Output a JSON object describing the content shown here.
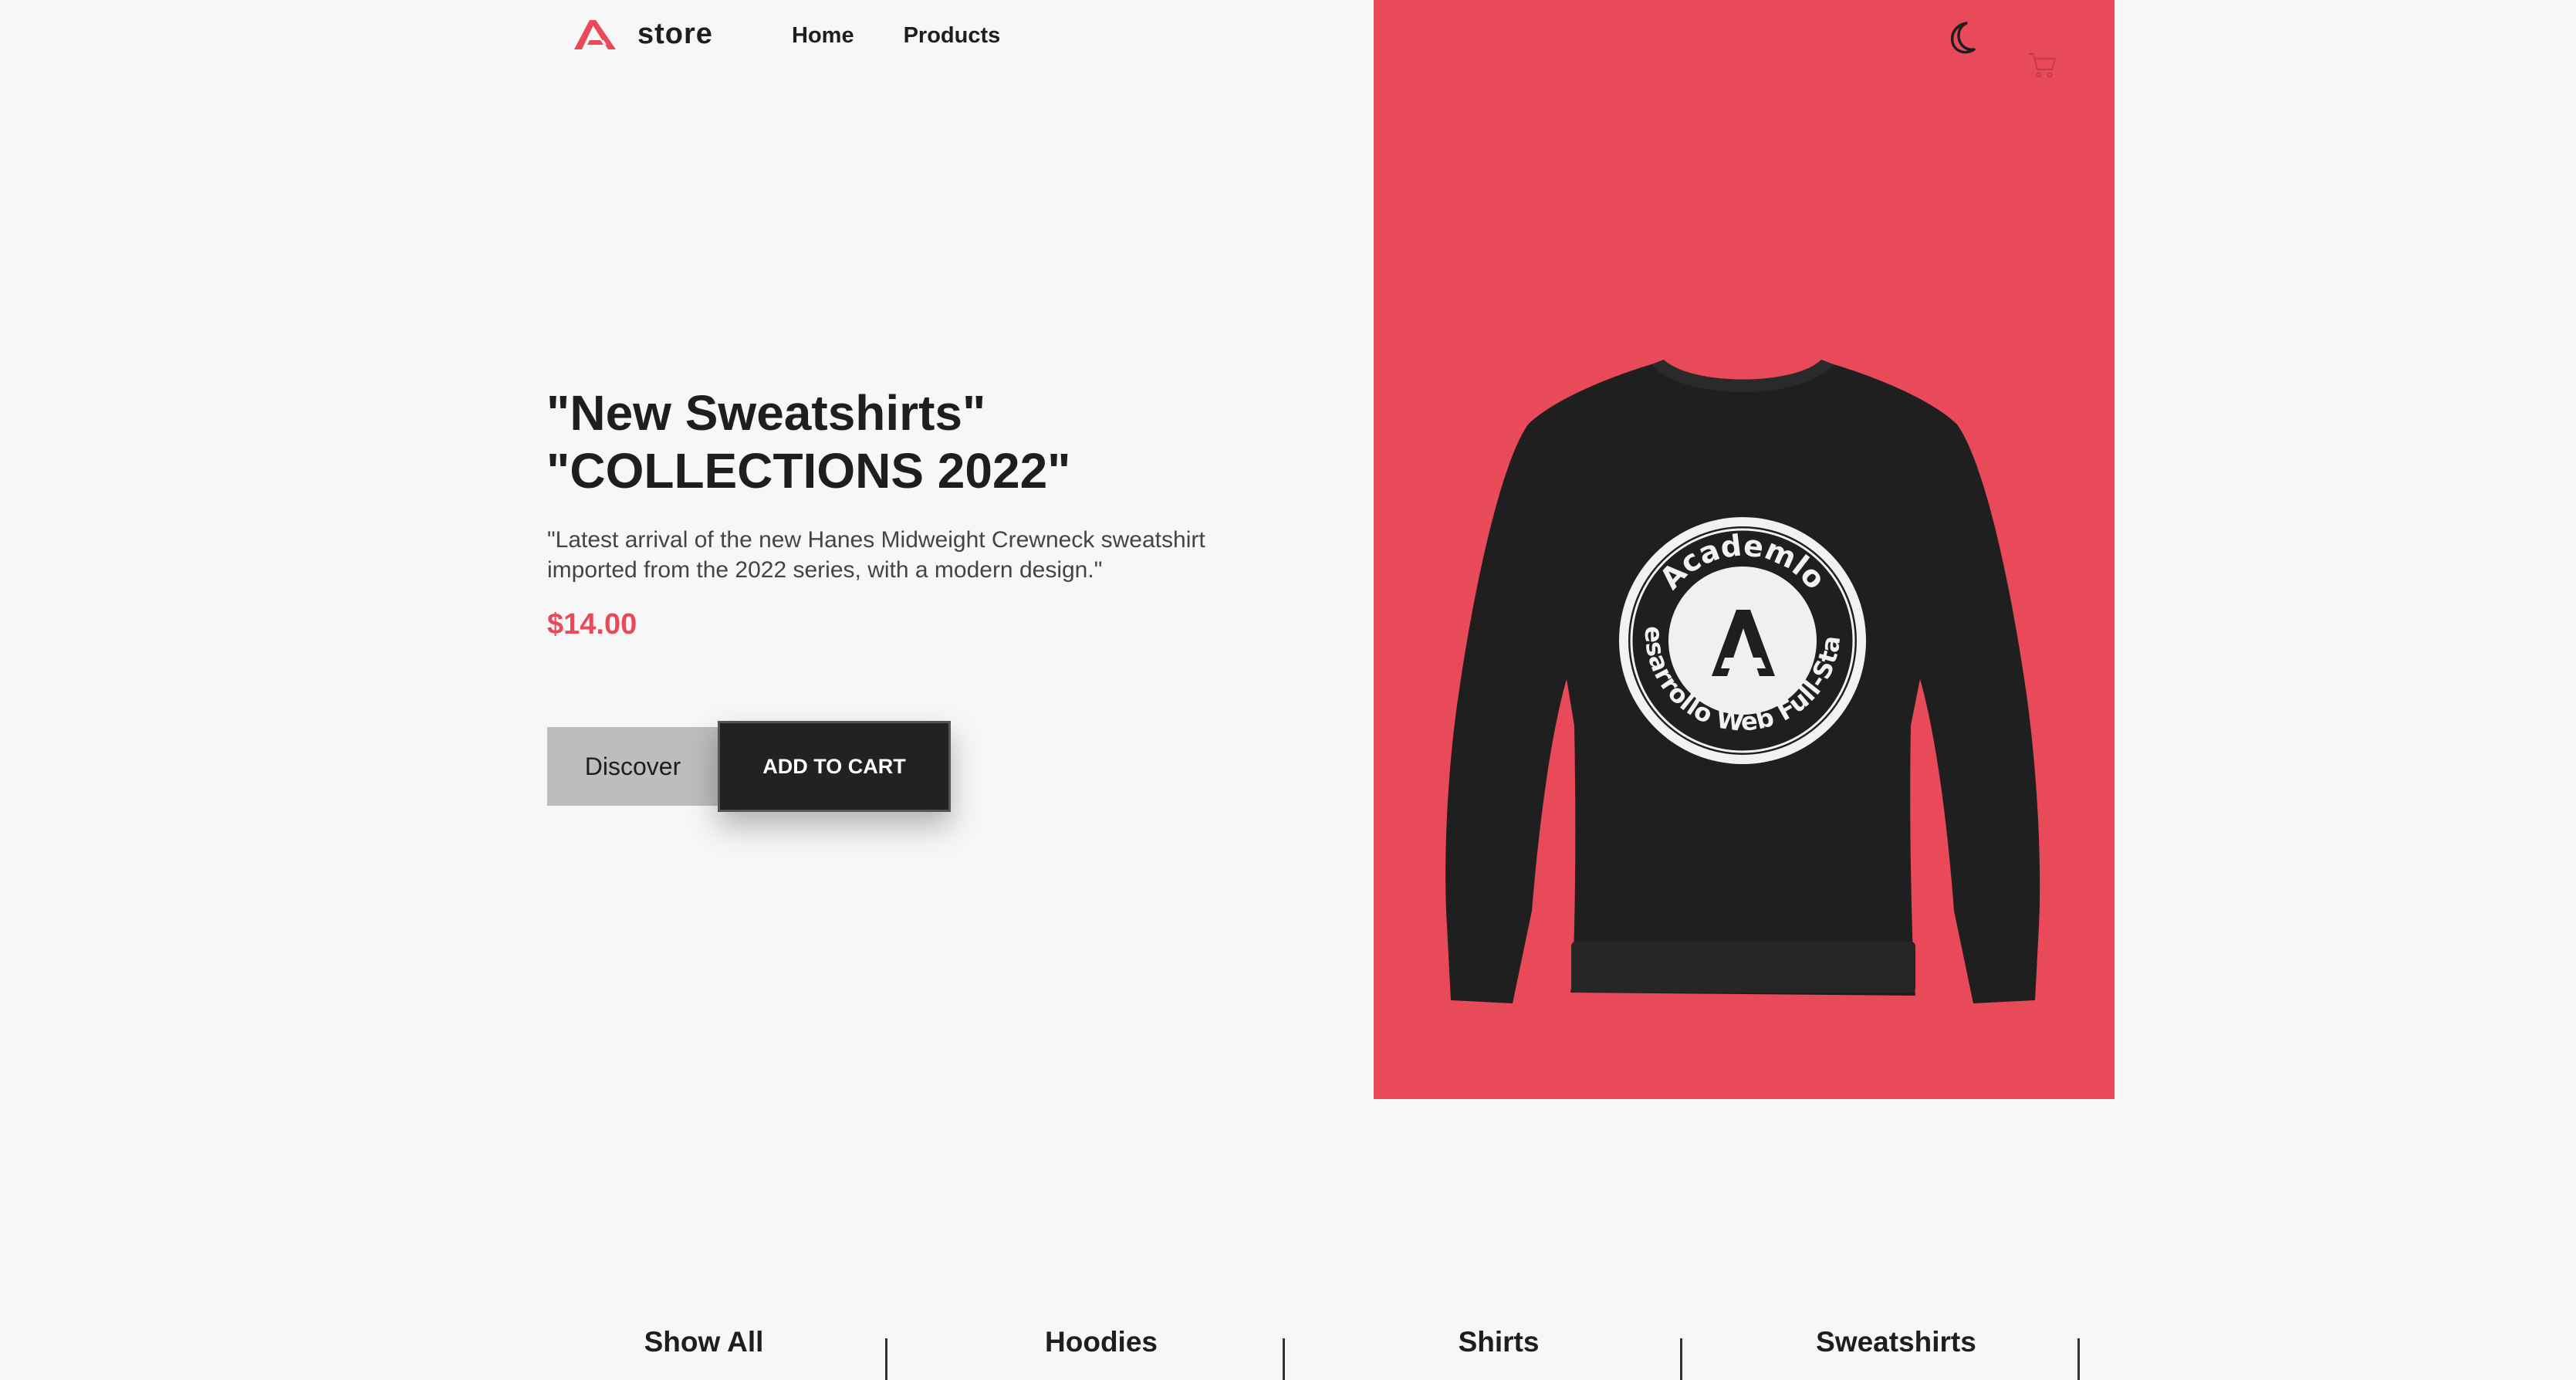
{
  "brand": {
    "name": "store",
    "accent_color": "#e84a5a",
    "logo_icon": "academlo-logo-icon"
  },
  "nav": {
    "items": [
      {
        "label": "Home"
      },
      {
        "label": "Products"
      }
    ]
  },
  "header_icons": {
    "theme_toggle": "moon-icon",
    "cart": "cart-icon"
  },
  "hero": {
    "title_line1": "\"New Sweatshirts\"",
    "title_line2": "\"COLLECTIONS 2022\"",
    "description": "\"Latest arrival of the new Hanes Midweight Crewneck sweatshirt imported from the 2022 series, with a modern design.\"",
    "price": "$14.00",
    "discover_label": "Discover",
    "add_to_cart_label": "ADD TO CART",
    "image_background": "#e84a5a",
    "product_badge": {
      "top_text": "Academlo",
      "bottom_text": "Desarrollo Web Full-Stack"
    }
  },
  "categories": [
    {
      "label": "Show All"
    },
    {
      "label": "Hoodies"
    },
    {
      "label": "Shirts"
    },
    {
      "label": "Sweatshirts"
    }
  ]
}
